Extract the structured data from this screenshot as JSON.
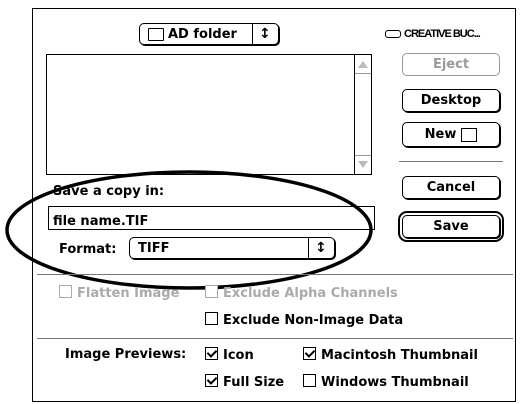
{
  "header": {
    "folder_popup_label": "AD folder",
    "folder_popup_arrows": "↕",
    "volume_label": "CREATIVE BUC..."
  },
  "buttons": {
    "eject": "Eject",
    "desktop": "Desktop",
    "new": "New",
    "cancel": "Cancel",
    "save": "Save"
  },
  "save_section": {
    "prompt": "Save a copy in:",
    "filename_value": "file name.TIF",
    "format_label": "Format:",
    "format_value": "TIFF",
    "format_arrows": "↕"
  },
  "options": {
    "flatten_image": "Flatten Image",
    "exclude_alpha": "Exclude Alpha Channels",
    "exclude_non_image": "Exclude Non-Image Data"
  },
  "previews": {
    "label": "Image Previews:",
    "icon": "Icon",
    "full_size": "Full Size",
    "mac_thumbnail": "Macintosh Thumbnail",
    "windows_thumbnail": "Windows Thumbnail"
  }
}
